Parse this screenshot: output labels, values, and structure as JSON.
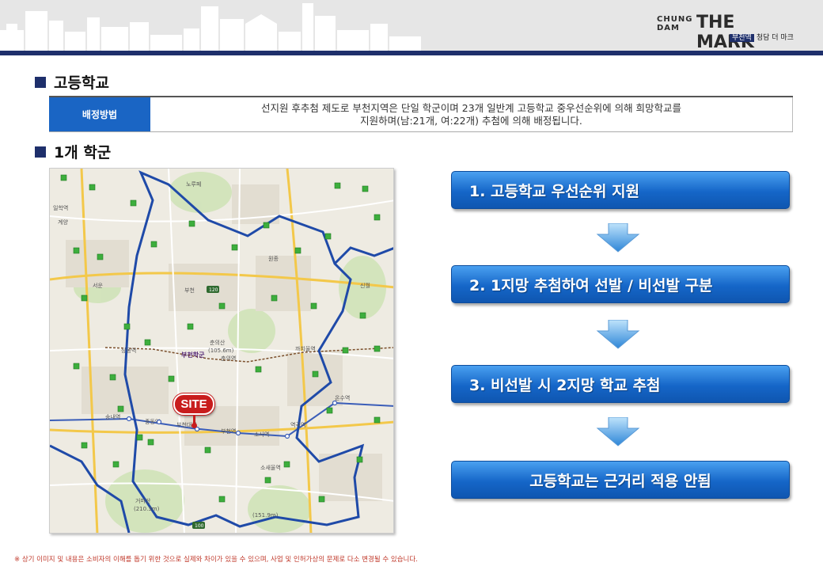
{
  "brand": {
    "line1": "CHUNG",
    "line2": "DAM",
    "name": "THE MARK",
    "station_tag": "부천역",
    "sub": "청담 더 마크"
  },
  "sections": {
    "high_school": "고등학교",
    "district": "1개 학군"
  },
  "allocation": {
    "header": "배정방법",
    "line1": "선지원 후추첨 제도로 부천지역은 단일 학군이며 23개 일반계 고등학교 중우선순위에 의해 희망학교를",
    "line2": "지원하며(남:21개, 여:22개) 추첨에 의해 배정됩니다."
  },
  "steps": [
    {
      "label": "1. 고등학교 우선순위 지원"
    },
    {
      "label": "2. 1지망 추첨하여 선발 / 비선발 구분"
    },
    {
      "label": "3. 비선발 시 2지망 학교 추첨"
    },
    {
      "label": "고등학교는 근거리 적용 안됨"
    }
  ],
  "map": {
    "site_label": "SITE",
    "place_labels": [
      "노루페",
      "일학역",
      "계양",
      "서운",
      "원종",
      "부천",
      "신월",
      "춘의산",
      "(105.6m)",
      "까치울역",
      "상동역",
      "춘의역",
      "부천역",
      "송내역",
      "중동역",
      "소사역",
      "역곡역",
      "온수역",
      "소새울역",
      "거마산",
      "(210.3m)",
      "(151.9m)",
      "부천대로"
    ],
    "school_label": "부천학군",
    "road_numbers": [
      "120",
      "100"
    ]
  },
  "colors": {
    "accent_blue": "#1a65c4",
    "navy": "#1e2f6b",
    "site_red": "#c81d1d",
    "boundary_blue": "#1f4aa8"
  },
  "footnote": "※ 상기 이미지 및 내용은 소비자의 이해를 돕기 위한 것으로 실제와 차이가 있을 수 있으며, 사업 및 인허가상의 문제로 다소 변경될 수 있습니다."
}
